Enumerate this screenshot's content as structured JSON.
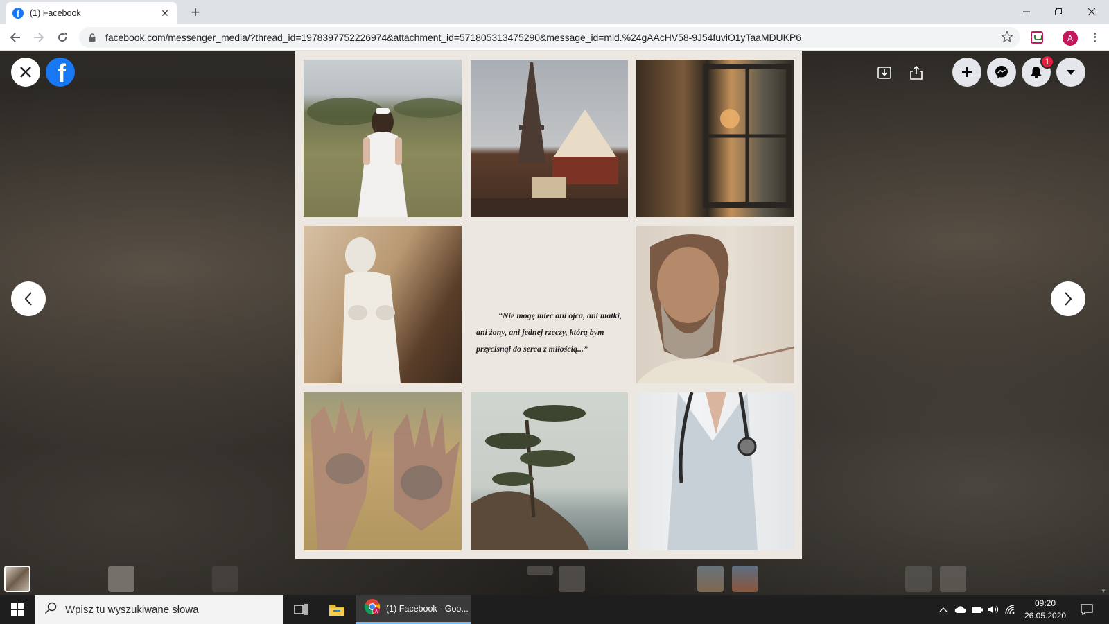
{
  "browser": {
    "tab_title": "(1) Facebook",
    "url": "facebook.com/messenger_media/?thread_id=1978397752226974&attachment_id=571805313475290&message_id=mid.%24gAAcHV58-9J54fuviO1yTaaMDUKP6",
    "profile_initial": "A"
  },
  "viewer": {
    "notification_count": "1",
    "icons": {
      "close": "close-icon",
      "logo": "facebook-logo",
      "tag": "tag-icon",
      "share": "share-icon",
      "create": "plus-icon",
      "messenger": "messenger-icon",
      "notifications": "bell-icon",
      "account": "caret-down-icon",
      "prev": "chevron-left-icon",
      "next": "chevron-right-icon"
    }
  },
  "collage": {
    "background": "#ece7e1",
    "quote": "“Nie mogę mieć ani ojca, ani matki, ani żony, ani jednej rzeczy, którą bym przycisnął do serca z miłością...”",
    "tiles": [
      {
        "name": "girl-in-white-dress-photo"
      },
      {
        "name": "eiffel-tower-carousel-photo"
      },
      {
        "name": "window-curtain-sunset-photo"
      },
      {
        "name": "venus-statue-photo"
      },
      {
        "name": "old-bearded-man-photo"
      },
      {
        "name": "dirty-hands-photo"
      },
      {
        "name": "pine-tree-coast-painting"
      },
      {
        "name": "doctor-stethoscope-photo"
      }
    ]
  },
  "taskbar": {
    "search_placeholder": "Wpisz tu wyszukiwane słowa",
    "chrome_window_label": "(1) Facebook - Goo...",
    "time": "09:20",
    "date": "26.05.2020",
    "accent": "#76b9ed"
  }
}
